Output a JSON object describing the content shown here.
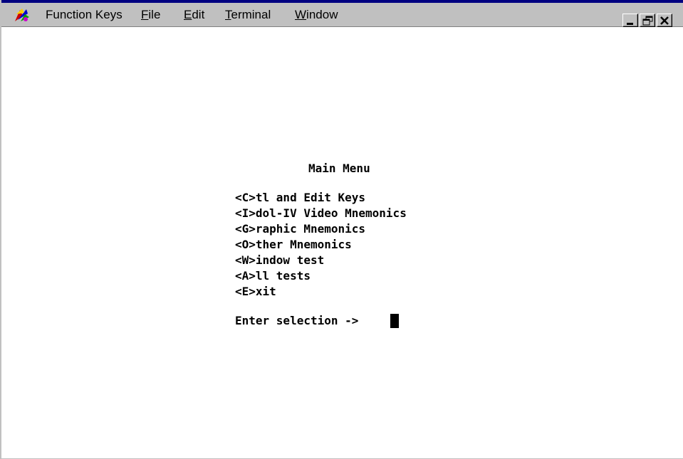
{
  "menubar": {
    "app_icon": "function-keys-app-icon",
    "items": [
      {
        "label": "Function Keys"
      },
      {
        "underline": "F",
        "rest": "ile"
      },
      {
        "underline": "E",
        "rest": "dit"
      },
      {
        "underline": "T",
        "rest": "erminal"
      },
      {
        "underline": "W",
        "rest": "indow"
      }
    ],
    "window_controls": [
      "minimize-icon",
      "restore-icon",
      "close-icon"
    ]
  },
  "terminal": {
    "title": "Main Menu",
    "options": [
      "<C>tl and Edit Keys",
      "<I>dol-IV Video Mnemonics",
      "<G>raphic Mnemonics",
      "<O>ther Mnemonics",
      "<W>indow test",
      "<A>ll tests",
      "<E>xit"
    ],
    "prompt": "Enter selection ->"
  },
  "colors": {
    "chrome": "#c0c0c0",
    "title_edge": "#000080",
    "terminal_bg": "#ffffff",
    "terminal_text": "#000000"
  }
}
